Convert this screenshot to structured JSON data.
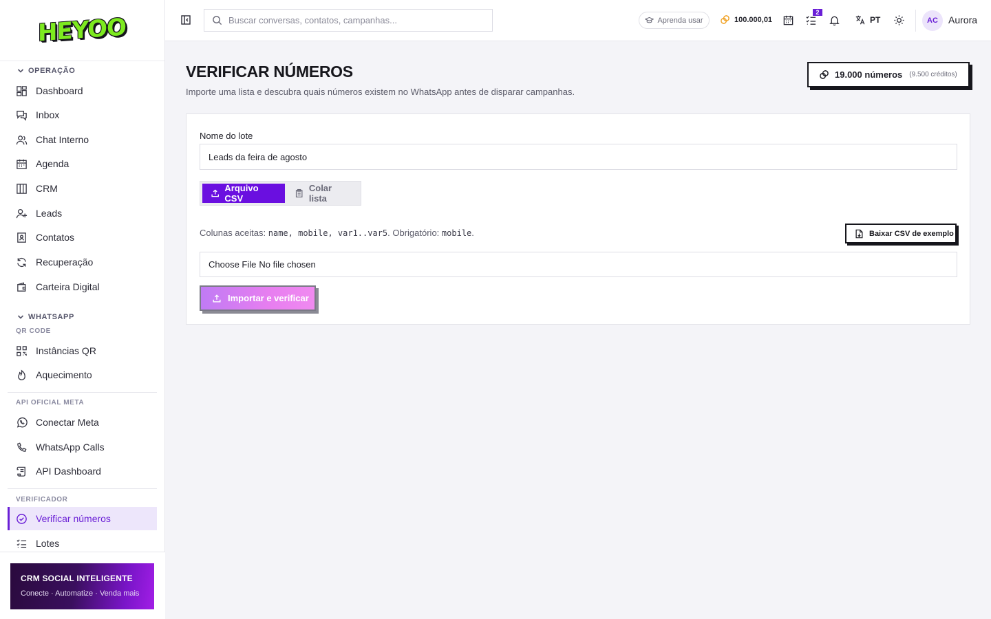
{
  "app": {
    "logo_text": "HEYOO"
  },
  "sidebar": {
    "group_operacao": "OPERAÇÃO",
    "operacao_items": [
      {
        "label": "Dashboard",
        "icon": "dashboard-icon"
      },
      {
        "label": "Inbox",
        "icon": "inbox-icon"
      },
      {
        "label": "Chat Interno",
        "icon": "users-icon"
      },
      {
        "label": "Agenda",
        "icon": "calendar-icon"
      },
      {
        "label": "CRM",
        "icon": "kanban-icon"
      },
      {
        "label": "Leads",
        "icon": "user-plus-icon"
      },
      {
        "label": "Contatos",
        "icon": "contacts-icon"
      },
      {
        "label": "Recuperação",
        "icon": "refresh-icon"
      },
      {
        "label": "Carteira Digital",
        "icon": "wallet-icon"
      }
    ],
    "group_whatsapp": "WHATSAPP",
    "sub_qr": "QR CODE",
    "qr_items": [
      {
        "label": "Instâncias QR",
        "icon": "qr-code-icon"
      },
      {
        "label": "Aquecimento",
        "icon": "flame-icon"
      }
    ],
    "sub_meta": "API OFICIAL META",
    "meta_items": [
      {
        "label": "Conectar Meta",
        "icon": "whatsapp-icon"
      },
      {
        "label": "WhatsApp Calls",
        "icon": "phone-icon"
      },
      {
        "label": "API Dashboard",
        "icon": "scroll-icon"
      }
    ],
    "sub_verificador": "VERIFICADOR",
    "verificador_items": [
      {
        "label": "Verificar números",
        "icon": "check-circle-icon",
        "active": true
      },
      {
        "label": "Lotes",
        "icon": "list-checks-icon"
      }
    ],
    "promo": {
      "title": "CRM SOCIAL INTELIGENTE",
      "subtitle": "Conecte · Automatize · Venda mais"
    }
  },
  "header": {
    "search_placeholder": "Buscar conversas, contatos, campanhas...",
    "learn_label": "Aprenda usar",
    "credits": "100.000,01",
    "tasks_badge": "2",
    "language": "PT",
    "user_initials": "AC",
    "user_name": "Aurora"
  },
  "main": {
    "title": "VERIFICAR NÚMEROS",
    "subtitle": "Importe uma lista e descubra quais números existem no WhatsApp antes de disparar campanhas.",
    "count_numbers": "19.000 números",
    "count_credits": "(9.500 créditos)",
    "form": {
      "batch_label": "Nome do lote",
      "batch_value": "Leads da feira de agosto",
      "tab_csv": "Arquivo CSV",
      "tab_paste": "Colar lista",
      "columns_prefix": "Colunas aceitas:",
      "columns_list": "name, mobile, var1..var5",
      "columns_required_label": ". Obrigatório:",
      "columns_required": "mobile",
      "columns_suffix": ".",
      "download_label": "Baixar CSV de exemplo",
      "file_button": "Choose File",
      "file_status": "No file chosen",
      "import_label": "Importar e verificar"
    }
  },
  "colors": {
    "accent": "#6a0fe0",
    "active_bg": "#ede6fb",
    "logo_green": "#7dea1f"
  }
}
